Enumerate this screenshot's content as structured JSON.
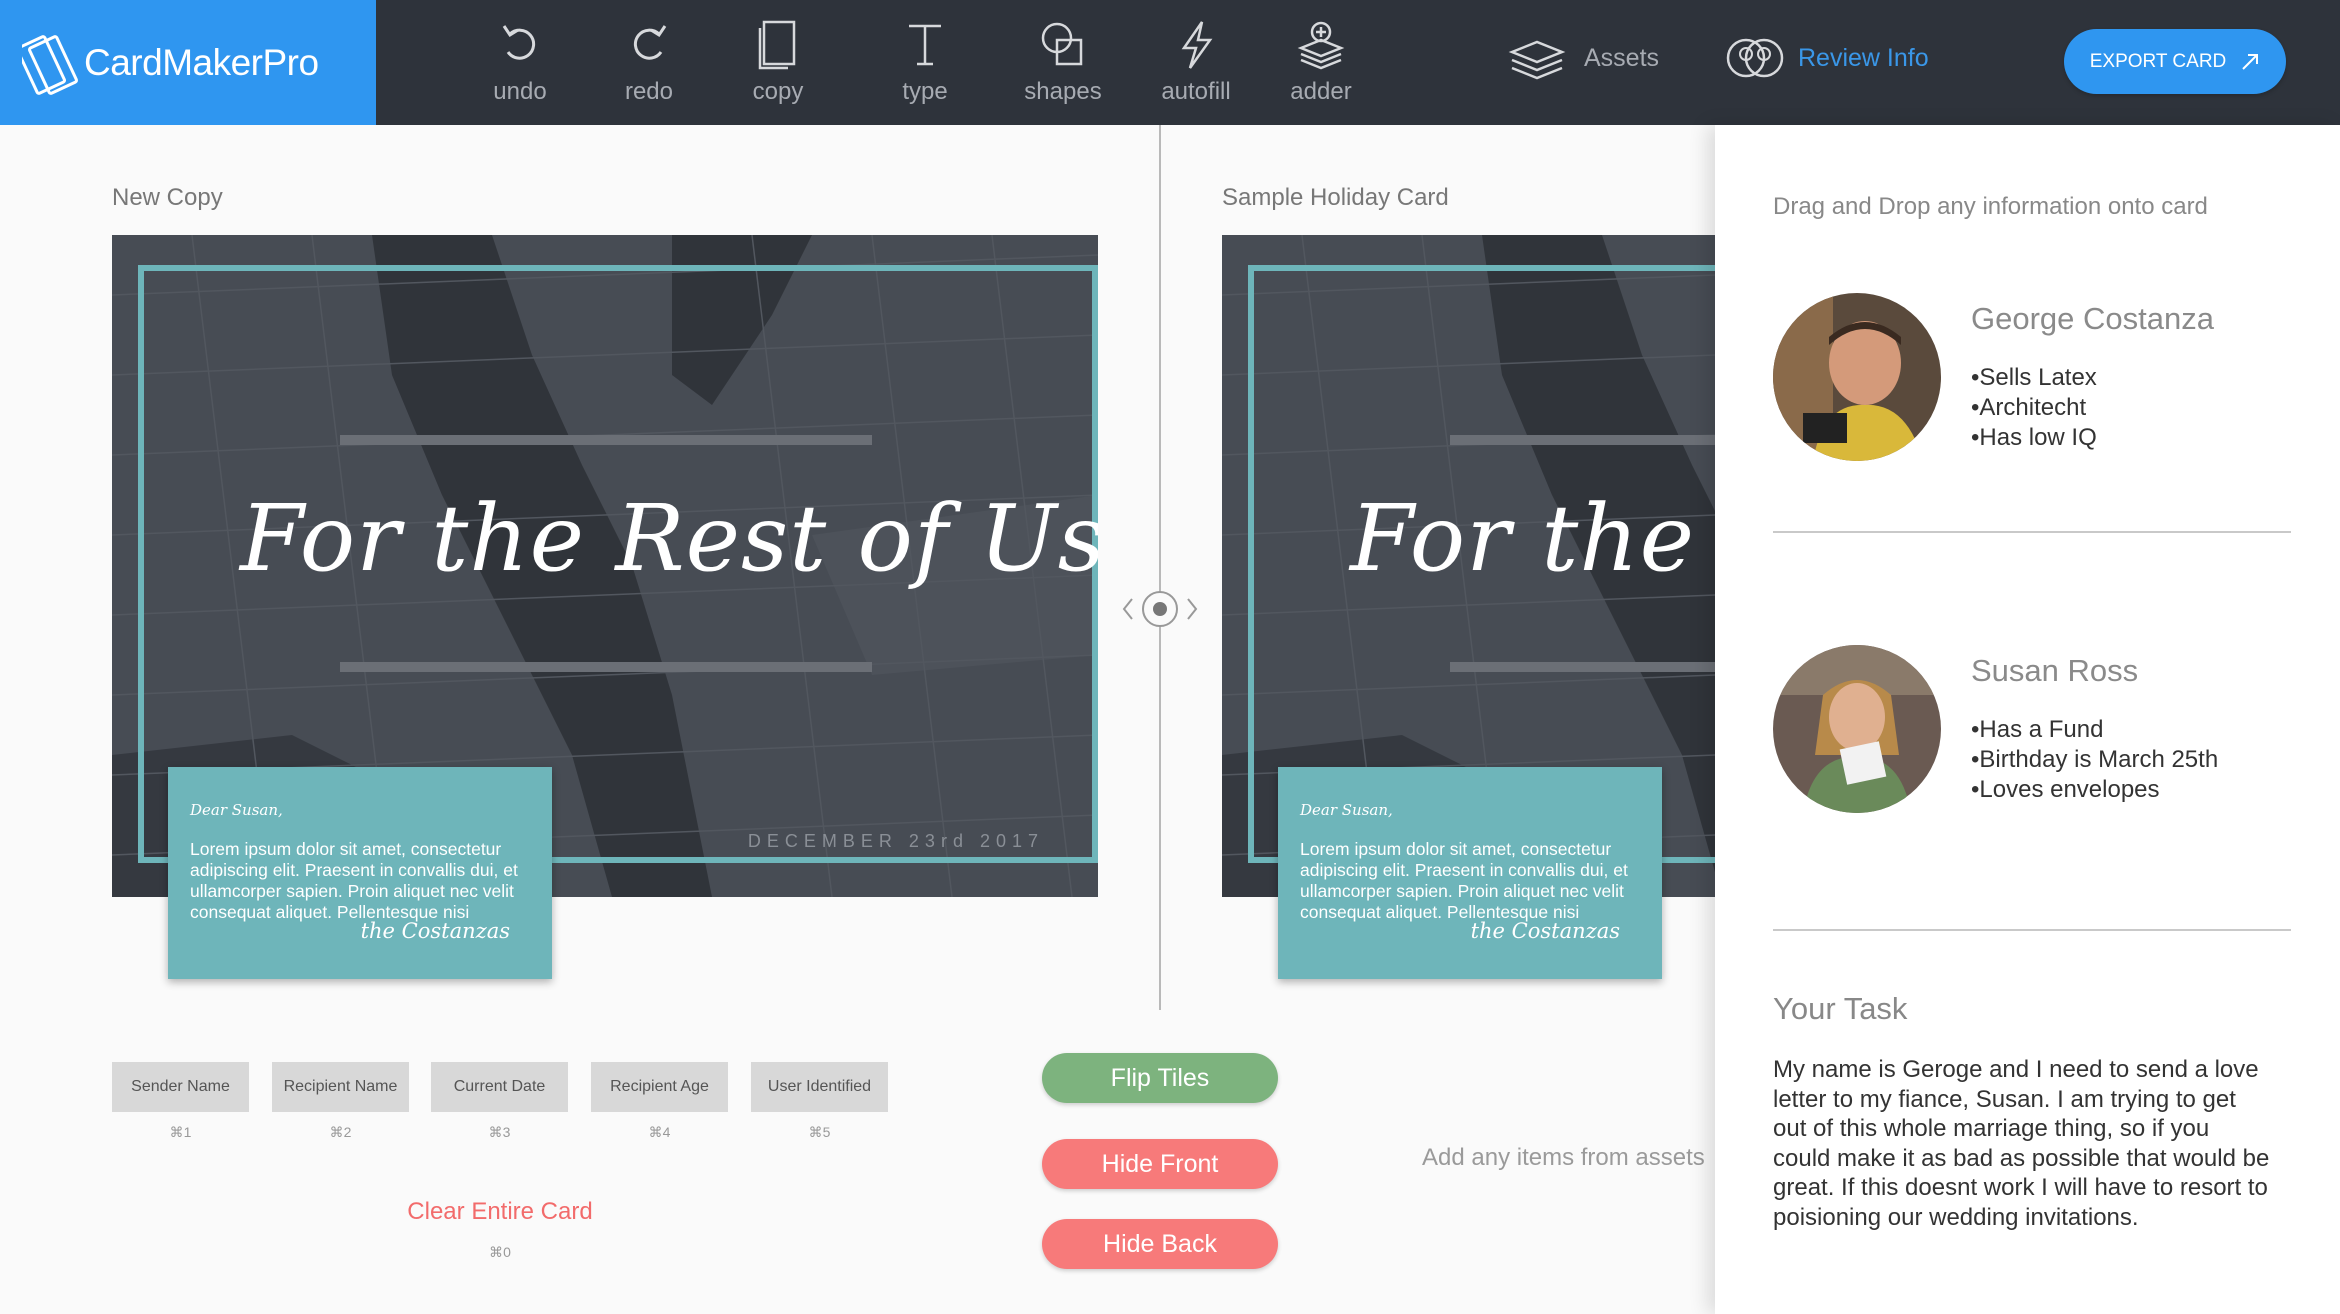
{
  "app": {
    "name": "CardMakerPro",
    "brand_color": "#2f96f0",
    "topbar_color": "#2e333b"
  },
  "toolbar": {
    "tools": [
      {
        "id": "undo",
        "label": "undo",
        "icon": "undo-icon"
      },
      {
        "id": "redo",
        "label": "redo",
        "icon": "redo-icon"
      },
      {
        "id": "copy",
        "label": "copy",
        "icon": "copy-icon"
      },
      {
        "id": "type",
        "label": "type",
        "icon": "type-icon"
      },
      {
        "id": "shapes",
        "label": "shapes",
        "icon": "shapes-icon"
      },
      {
        "id": "autofill",
        "label": "autofill",
        "icon": "lightning-icon"
      },
      {
        "id": "adder",
        "label": "adder",
        "icon": "layers-add-icon"
      }
    ],
    "assets_label": "Assets",
    "review_label": "Review Info",
    "export_label": "EXPORT CARD"
  },
  "left_pane": {
    "title": "New Copy",
    "card": {
      "title": "For the Rest of Us",
      "date": "DECEMBER 23rd 2017",
      "note": {
        "greeting": "Dear Susan,",
        "body": "Lorem ipsum dolor sit amet, consectetur adipiscing elit. Praesent in convallis dui, et ullamcorper sapien. Proin aliquet nec velit consequat aliquet. Pellentesque nisi",
        "signature": "the Costanzas"
      }
    }
  },
  "right_pane": {
    "title": "Sample Holiday Card",
    "card": {
      "title": "For the Rest of Us",
      "note": {
        "greeting": "Dear Susan,",
        "body": "Lorem ipsum dolor sit amet, consectetur adipiscing elit. Praesent in convallis dui, et ullamcorper sapien. Proin aliquet nec velit consequat aliquet. Pellentesque nisi",
        "signature": "the Costanzas"
      }
    },
    "hint": "Add any items from assets"
  },
  "tokens": [
    {
      "label": "Sender Name",
      "shortcut": "⌘1"
    },
    {
      "label": "Recipient Name",
      "shortcut": "⌘2"
    },
    {
      "label": "Current Date",
      "shortcut": "⌘3"
    },
    {
      "label": "Recipient Age",
      "shortcut": "⌘4"
    },
    {
      "label": "User Identified",
      "shortcut": "⌘5"
    }
  ],
  "clear": {
    "label": "Clear Entire Card",
    "shortcut": "⌘0"
  },
  "actions": {
    "flip": "Flip Tiles",
    "hide_front": "Hide Front",
    "hide_back": "Hide Back"
  },
  "info_panel": {
    "intro": "Drag and Drop any information onto card",
    "people": [
      {
        "name": "George Costanza",
        "facts": [
          "•Sells Latex",
          "•Architecht",
          "•Has low IQ"
        ]
      },
      {
        "name": "Susan Ross",
        "facts": [
          "•Has a Fund",
          "•Birthday is March 25th",
          "•Loves envelopes"
        ]
      }
    ],
    "task_title": "Your Task",
    "task_body": "My name is Geroge and I need to send a love letter to my fiance, Susan. I am trying to get out of this whole marriage thing, so if you could make it as bad as possible that would be great. If this doesnt work I will have to resort to poisioning our wedding invitations."
  },
  "colors": {
    "card_bg": "#3e434b",
    "card_accent": "#6eb5ba",
    "flip_button": "#7db37e",
    "hide_button": "#f77a7a",
    "clear_link": "#f26b6b",
    "review_link": "#3a97e8"
  }
}
